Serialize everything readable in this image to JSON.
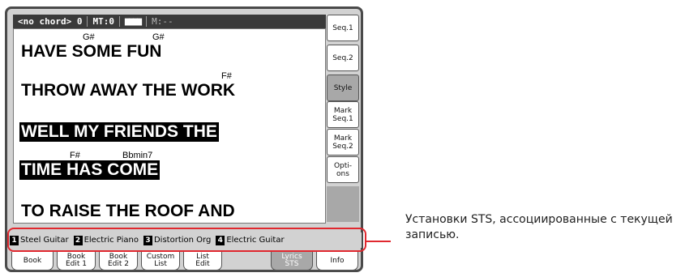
{
  "status": {
    "chord": "<no chord> 0",
    "mt": "MT:0",
    "meter": "▆▆▆▆",
    "measure": "M:--"
  },
  "lyrics": [
    {
      "text": "HAVE SOME FUN",
      "highlighted": false,
      "chords": [
        "G#",
        "G#"
      ]
    },
    {
      "text": "THROW AWAY THE WORK",
      "highlighted": false,
      "chords": [
        "F#"
      ]
    },
    {
      "text": "WELL MY FRIENDS THE",
      "highlighted": true,
      "chords": []
    },
    {
      "text": "TIME HAS COME",
      "highlighted": true,
      "chords": [
        "F#",
        "Bbmin7"
      ]
    },
    {
      "text": "TO RAISE THE ROOF AND",
      "highlighted": false,
      "chords": []
    }
  ],
  "side_buttons": [
    {
      "label": "Seq.1",
      "active": false
    },
    {
      "label": "Seq.2",
      "active": false
    },
    {
      "label": "Style",
      "active": true
    },
    {
      "label": "Mark\nSeq.1",
      "active": false
    },
    {
      "label": "Mark\nSeq.2",
      "active": false
    },
    {
      "label": "Opti-\nons",
      "active": false
    }
  ],
  "sts": [
    {
      "num": "1",
      "name": "Steel Guitar"
    },
    {
      "num": "2",
      "name": "Electric Piano"
    },
    {
      "num": "3",
      "name": "Distortion Org"
    },
    {
      "num": "4",
      "name": "Electric Guitar"
    }
  ],
  "tabs": [
    {
      "label": "Book",
      "active": false
    },
    {
      "label": "Book\nEdit 1",
      "active": false
    },
    {
      "label": "Book\nEdit 2",
      "active": false
    },
    {
      "label": "Custom\nList",
      "active": false
    },
    {
      "label": "List\nEdit",
      "active": false
    },
    {
      "label": "Lyrics\nSTS",
      "active": true
    },
    {
      "label": "Info",
      "active": false
    }
  ],
  "callout": "Установки STS, ассоциированные с текущей записью.",
  "colors": {
    "callout_red": "#e0282f",
    "active_gray": "#a8a8a8",
    "statusbar": "#3a3a3a"
  }
}
